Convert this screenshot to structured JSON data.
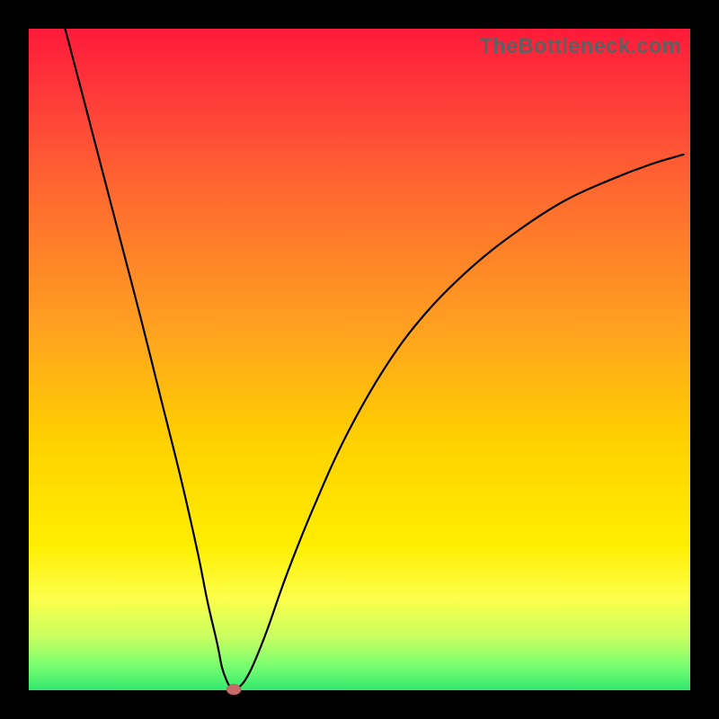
{
  "watermark": "TheBottleneck.com",
  "chart_data": {
    "type": "line",
    "title": "",
    "xlabel": "",
    "ylabel": "",
    "xlim": [
      0,
      100
    ],
    "ylim": [
      0,
      100
    ],
    "series": [
      {
        "name": "bottleneck-curve",
        "x": [
          5.5,
          8,
          11,
          14,
          17,
          20,
          23,
          25.5,
          27,
          28.5,
          29.2,
          29.9,
          30.5,
          31,
          31.7,
          32.7,
          34,
          36,
          39,
          43,
          48,
          54,
          60,
          67,
          74,
          81,
          88,
          94,
          99
        ],
        "values": [
          100,
          90.5,
          79,
          67.5,
          56,
          44,
          32,
          21,
          13.5,
          7,
          3.5,
          1.5,
          0.4,
          0.1,
          0.4,
          1.5,
          4,
          9,
          17.5,
          27.5,
          38.5,
          49,
          57,
          64,
          69.5,
          74,
          77.2,
          79.5,
          81
        ]
      }
    ],
    "marker": {
      "x": 31,
      "y": 0.1,
      "rx": 1.1,
      "ry": 0.8
    },
    "background_gradient": [
      "#ff1a3a",
      "#ff6a2f",
      "#ffd000",
      "#fdff4a",
      "#33e96f"
    ]
  }
}
